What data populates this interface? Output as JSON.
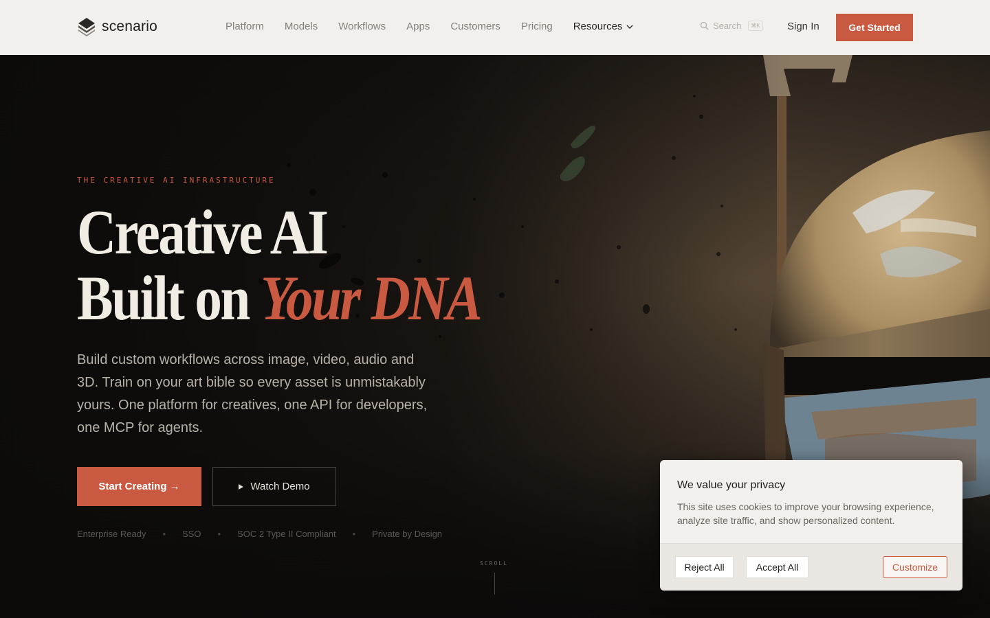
{
  "brand": {
    "name": "scenario"
  },
  "nav": {
    "items": [
      "Platform",
      "Models",
      "Workflows",
      "Apps",
      "Customers",
      "Pricing"
    ],
    "resources_label": "Resources",
    "search_placeholder": "Search",
    "search_shortcut": "⌘K",
    "sign_in": "Sign In",
    "get_started": "Get Started"
  },
  "hero": {
    "eyebrow": "THE CREATIVE AI INFRASTRUCTURE",
    "headline_line1": "Creative AI",
    "headline_line2_plain": "Built on ",
    "headline_line2_accent": "Your DNA",
    "subtitle": "Build custom workflows across image, video, audio and 3D. Train on your art bible so every asset is unmistakably yours. One platform for creatives, one API for developers, one MCP for agents.",
    "primary_cta": "Start Creating →",
    "secondary_cta": "Watch Demo",
    "badges": [
      "Enterprise Ready",
      "SSO",
      "SOC 2 Type II Compliant",
      "Private by Design"
    ],
    "badge_separator": "•",
    "scroll_label": "SCROLL"
  },
  "cookie": {
    "title": "We value your privacy",
    "body": "This site uses cookies to improve your browsing experience, analyze site traffic, and show personalized content.",
    "reject": "Reject All",
    "accept": "Accept All",
    "customize": "Customize"
  },
  "colors": {
    "accent": "#c95a41",
    "header_bg": "#f2f0ed",
    "hero_bg": "#0d0c0b"
  }
}
